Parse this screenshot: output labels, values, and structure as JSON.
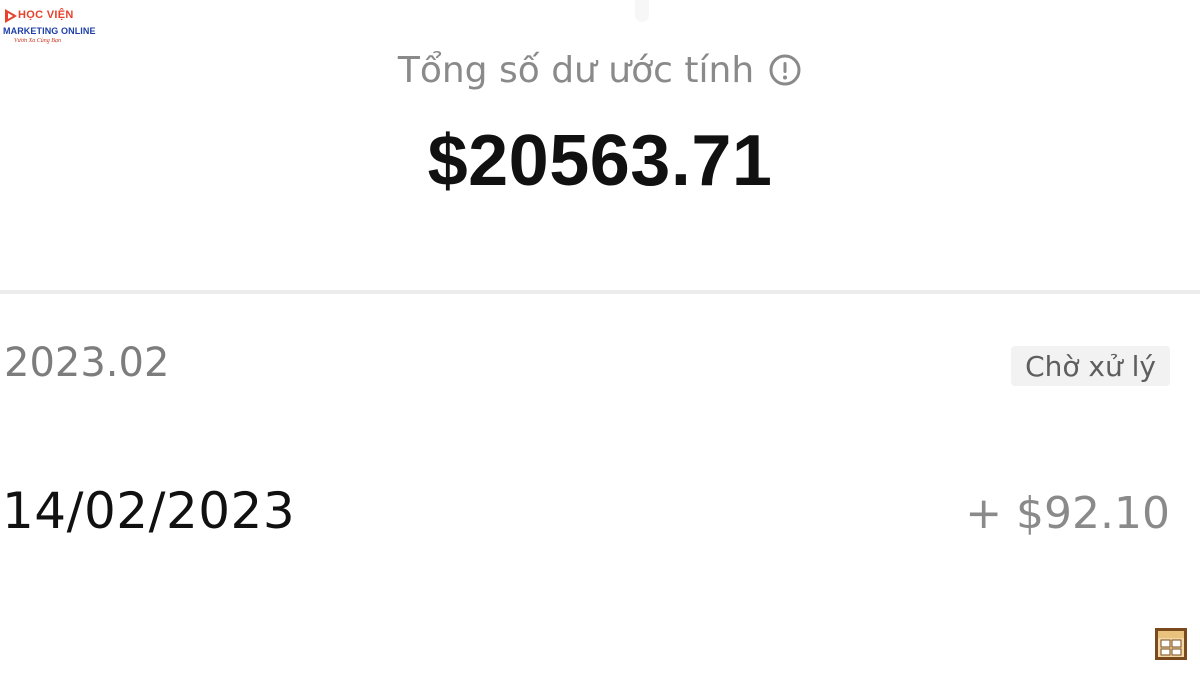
{
  "watermark": {
    "line1": "HỌC VIỆN",
    "line2": "MARKETING ONLINE",
    "line3": "Vươn Xa Cùng Bạn",
    "colors": {
      "red": "#e8412c",
      "blue": "#1e3fa8"
    }
  },
  "summary": {
    "label": "Tổng số dư ước tính",
    "info_icon": "info-circle-icon",
    "balance": "$20563.71"
  },
  "period": {
    "label": "2023.02",
    "status": "Chờ xử lý"
  },
  "transactions": [
    {
      "date": "14/02/2023",
      "amount": "+ $92.10"
    }
  ],
  "overlay_icon": "video-frame-icon"
}
